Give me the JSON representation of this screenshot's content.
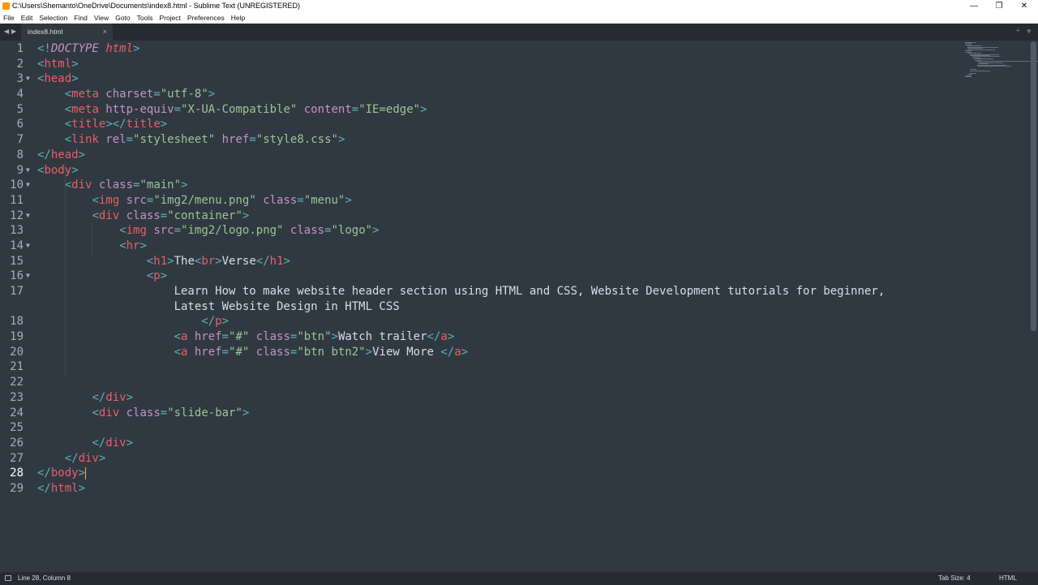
{
  "window": {
    "title": "C:\\Users\\Shemanto\\OneDrive\\Documents\\index8.html - Sublime Text (UNREGISTERED)",
    "minimize_glyph": "—",
    "restore_glyph": "❐",
    "close_glyph": "✕"
  },
  "menu": [
    "File",
    "Edit",
    "Selection",
    "Find",
    "View",
    "Goto",
    "Tools",
    "Project",
    "Preferences",
    "Help"
  ],
  "tabs": {
    "prev_arrow": "◀",
    "next_arrow": "▶",
    "active": {
      "label": "index8.html",
      "close": "×"
    },
    "new_tab_glyph": "+",
    "tab_list_glyph": "▾"
  },
  "editor": {
    "active_line": 28,
    "fold_glyph": "▼",
    "colors": {
      "tag": "#ec5f67",
      "attr": "#c594c5",
      "string": "#99c794",
      "punct": "#5fb3b3",
      "text": "#d8dee9",
      "background": "#303841",
      "cursor": "#f9ae58"
    },
    "lines": [
      {
        "n": "1",
        "fold": false,
        "tokens": [
          {
            "t": "<!",
            "c": "punct"
          },
          {
            "t": "DOCTYPE",
            "c": "attr",
            "i": true
          },
          {
            "t": " ",
            "c": "text"
          },
          {
            "t": "html",
            "c": "tag",
            "i": true
          },
          {
            "t": ">",
            "c": "punct"
          }
        ]
      },
      {
        "n": "2",
        "fold": false,
        "tokens": [
          {
            "t": "<",
            "c": "punct"
          },
          {
            "t": "html",
            "c": "tag"
          },
          {
            "t": ">",
            "c": "punct"
          }
        ]
      },
      {
        "n": "3",
        "fold": true,
        "tokens": [
          {
            "t": "<",
            "c": "punct"
          },
          {
            "t": "head",
            "c": "tag"
          },
          {
            "t": ">",
            "c": "punct"
          }
        ]
      },
      {
        "n": "4",
        "fold": false,
        "tokens": [
          {
            "t": "    ",
            "c": "text"
          },
          {
            "t": "<",
            "c": "punct"
          },
          {
            "t": "meta",
            "c": "tag"
          },
          {
            "t": " charset",
            "c": "attr"
          },
          {
            "t": "=",
            "c": "punct"
          },
          {
            "t": "\"utf-8\"",
            "c": "string"
          },
          {
            "t": ">",
            "c": "punct"
          }
        ]
      },
      {
        "n": "5",
        "fold": false,
        "tokens": [
          {
            "t": "    ",
            "c": "text"
          },
          {
            "t": "<",
            "c": "punct"
          },
          {
            "t": "meta",
            "c": "tag"
          },
          {
            "t": " http-equiv",
            "c": "attr"
          },
          {
            "t": "=",
            "c": "punct"
          },
          {
            "t": "\"X-UA-Compatible\"",
            "c": "string"
          },
          {
            "t": " content",
            "c": "attr"
          },
          {
            "t": "=",
            "c": "punct"
          },
          {
            "t": "\"IE=edge\"",
            "c": "string"
          },
          {
            "t": ">",
            "c": "punct"
          }
        ]
      },
      {
        "n": "6",
        "fold": false,
        "tokens": [
          {
            "t": "    ",
            "c": "text"
          },
          {
            "t": "<",
            "c": "punct"
          },
          {
            "t": "title",
            "c": "tag"
          },
          {
            "t": "></",
            "c": "punct"
          },
          {
            "t": "title",
            "c": "tag"
          },
          {
            "t": ">",
            "c": "punct"
          }
        ]
      },
      {
        "n": "7",
        "fold": false,
        "tokens": [
          {
            "t": "    ",
            "c": "text"
          },
          {
            "t": "<",
            "c": "punct"
          },
          {
            "t": "link",
            "c": "tag"
          },
          {
            "t": " rel",
            "c": "attr"
          },
          {
            "t": "=",
            "c": "punct"
          },
          {
            "t": "\"stylesheet\"",
            "c": "string"
          },
          {
            "t": " href",
            "c": "attr"
          },
          {
            "t": "=",
            "c": "punct"
          },
          {
            "t": "\"style8.css\"",
            "c": "string"
          },
          {
            "t": ">",
            "c": "punct"
          }
        ]
      },
      {
        "n": "8",
        "fold": false,
        "tokens": [
          {
            "t": "</",
            "c": "punct"
          },
          {
            "t": "head",
            "c": "tag"
          },
          {
            "t": ">",
            "c": "punct"
          }
        ]
      },
      {
        "n": "9",
        "fold": true,
        "tokens": [
          {
            "t": "<",
            "c": "punct"
          },
          {
            "t": "body",
            "c": "tag"
          },
          {
            "t": ">",
            "c": "punct"
          }
        ]
      },
      {
        "n": "10",
        "fold": true,
        "tokens": [
          {
            "t": "    ",
            "c": "text"
          },
          {
            "t": "<",
            "c": "punct"
          },
          {
            "t": "div",
            "c": "tag"
          },
          {
            "t": " class",
            "c": "attr"
          },
          {
            "t": "=",
            "c": "punct"
          },
          {
            "t": "\"main\"",
            "c": "string"
          },
          {
            "t": ">",
            "c": "punct"
          }
        ]
      },
      {
        "n": "11",
        "fold": false,
        "tokens": [
          {
            "t": "        ",
            "c": "text"
          },
          {
            "t": "<",
            "c": "punct"
          },
          {
            "t": "img",
            "c": "tag"
          },
          {
            "t": " src",
            "c": "attr"
          },
          {
            "t": "=",
            "c": "punct"
          },
          {
            "t": "\"img2/menu.png\"",
            "c": "string"
          },
          {
            "t": " class",
            "c": "attr"
          },
          {
            "t": "=",
            "c": "punct"
          },
          {
            "t": "\"menu\"",
            "c": "string"
          },
          {
            "t": ">",
            "c": "punct"
          }
        ]
      },
      {
        "n": "12",
        "fold": true,
        "tokens": [
          {
            "t": "        ",
            "c": "text"
          },
          {
            "t": "<",
            "c": "punct"
          },
          {
            "t": "div",
            "c": "tag"
          },
          {
            "t": " class",
            "c": "attr"
          },
          {
            "t": "=",
            "c": "punct"
          },
          {
            "t": "\"container\"",
            "c": "string"
          },
          {
            "t": ">",
            "c": "punct"
          }
        ]
      },
      {
        "n": "13",
        "fold": false,
        "tokens": [
          {
            "t": "            ",
            "c": "text"
          },
          {
            "t": "<",
            "c": "punct"
          },
          {
            "t": "img",
            "c": "tag"
          },
          {
            "t": " src",
            "c": "attr"
          },
          {
            "t": "=",
            "c": "punct"
          },
          {
            "t": "\"img2/logo.png\"",
            "c": "string"
          },
          {
            "t": " class",
            "c": "attr"
          },
          {
            "t": "=",
            "c": "punct"
          },
          {
            "t": "\"logo\"",
            "c": "string"
          },
          {
            "t": ">",
            "c": "punct"
          }
        ]
      },
      {
        "n": "14",
        "fold": true,
        "tokens": [
          {
            "t": "            ",
            "c": "text"
          },
          {
            "t": "<",
            "c": "punct"
          },
          {
            "t": "hr",
            "c": "tag"
          },
          {
            "t": ">",
            "c": "punct"
          }
        ]
      },
      {
        "n": "15",
        "fold": false,
        "tokens": [
          {
            "t": "                ",
            "c": "text"
          },
          {
            "t": "<",
            "c": "punct"
          },
          {
            "t": "h1",
            "c": "tag"
          },
          {
            "t": ">",
            "c": "punct"
          },
          {
            "t": "The",
            "c": "text"
          },
          {
            "t": "<",
            "c": "punct"
          },
          {
            "t": "br",
            "c": "tag"
          },
          {
            "t": ">",
            "c": "punct"
          },
          {
            "t": "Verse",
            "c": "text"
          },
          {
            "t": "</",
            "c": "punct"
          },
          {
            "t": "h1",
            "c": "tag"
          },
          {
            "t": ">",
            "c": "punct"
          }
        ]
      },
      {
        "n": "16",
        "fold": true,
        "tokens": [
          {
            "t": "                ",
            "c": "text"
          },
          {
            "t": "<",
            "c": "punct"
          },
          {
            "t": "p",
            "c": "tag"
          },
          {
            "t": ">",
            "c": "punct"
          }
        ]
      },
      {
        "n": "17",
        "fold": false,
        "tokens": [
          {
            "t": "                    Learn How to make website header section using HTML and CSS, Website Development tutorials for beginner,",
            "c": "text"
          }
        ]
      },
      {
        "n": "",
        "fold": false,
        "tokens": [
          {
            "t": "                    Latest Website Design in HTML CSS",
            "c": "text"
          }
        ]
      },
      {
        "n": "18",
        "fold": false,
        "tokens": [
          {
            "t": "                        ",
            "c": "text"
          },
          {
            "t": "</",
            "c": "punct"
          },
          {
            "t": "p",
            "c": "tag"
          },
          {
            "t": ">",
            "c": "punct"
          }
        ]
      },
      {
        "n": "19",
        "fold": false,
        "tokens": [
          {
            "t": "                    ",
            "c": "text"
          },
          {
            "t": "<",
            "c": "punct"
          },
          {
            "t": "a",
            "c": "tag"
          },
          {
            "t": " href",
            "c": "attr"
          },
          {
            "t": "=",
            "c": "punct"
          },
          {
            "t": "\"#\"",
            "c": "string"
          },
          {
            "t": " class",
            "c": "attr"
          },
          {
            "t": "=",
            "c": "punct"
          },
          {
            "t": "\"btn\"",
            "c": "string"
          },
          {
            "t": ">",
            "c": "punct"
          },
          {
            "t": "Watch trailer",
            "c": "text"
          },
          {
            "t": "</",
            "c": "punct"
          },
          {
            "t": "a",
            "c": "tag"
          },
          {
            "t": ">",
            "c": "punct"
          }
        ]
      },
      {
        "n": "20",
        "fold": false,
        "tokens": [
          {
            "t": "                    ",
            "c": "text"
          },
          {
            "t": "<",
            "c": "punct"
          },
          {
            "t": "a",
            "c": "tag"
          },
          {
            "t": " href",
            "c": "attr"
          },
          {
            "t": "=",
            "c": "punct"
          },
          {
            "t": "\"#\"",
            "c": "string"
          },
          {
            "t": " class",
            "c": "attr"
          },
          {
            "t": "=",
            "c": "punct"
          },
          {
            "t": "\"btn btn2\"",
            "c": "string"
          },
          {
            "t": ">",
            "c": "punct"
          },
          {
            "t": "View More ",
            "c": "text"
          },
          {
            "t": "</",
            "c": "punct"
          },
          {
            "t": "a",
            "c": "tag"
          },
          {
            "t": ">",
            "c": "punct"
          }
        ]
      },
      {
        "n": "21",
        "fold": false,
        "tokens": []
      },
      {
        "n": "22",
        "fold": false,
        "tokens": []
      },
      {
        "n": "23",
        "fold": false,
        "tokens": [
          {
            "t": "        ",
            "c": "text"
          },
          {
            "t": "</",
            "c": "punct"
          },
          {
            "t": "div",
            "c": "tag"
          },
          {
            "t": ">",
            "c": "punct"
          }
        ]
      },
      {
        "n": "24",
        "fold": false,
        "tokens": [
          {
            "t": "        ",
            "c": "text"
          },
          {
            "t": "<",
            "c": "punct"
          },
          {
            "t": "div",
            "c": "tag"
          },
          {
            "t": " class",
            "c": "attr"
          },
          {
            "t": "=",
            "c": "punct"
          },
          {
            "t": "\"slide-bar\"",
            "c": "string"
          },
          {
            "t": ">",
            "c": "punct"
          }
        ]
      },
      {
        "n": "25",
        "fold": false,
        "tokens": []
      },
      {
        "n": "26",
        "fold": false,
        "tokens": [
          {
            "t": "        ",
            "c": "text"
          },
          {
            "t": "</",
            "c": "punct"
          },
          {
            "t": "div",
            "c": "tag"
          },
          {
            "t": ">",
            "c": "punct"
          }
        ]
      },
      {
        "n": "27",
        "fold": false,
        "tokens": [
          {
            "t": "    ",
            "c": "text"
          },
          {
            "t": "</",
            "c": "punct"
          },
          {
            "t": "div",
            "c": "tag"
          },
          {
            "t": ">",
            "c": "punct"
          }
        ]
      },
      {
        "n": "28",
        "fold": false,
        "cursor": true,
        "tokens": [
          {
            "t": "</",
            "c": "punct"
          },
          {
            "t": "body",
            "c": "tag"
          },
          {
            "t": ">",
            "c": "punct"
          }
        ]
      },
      {
        "n": "29",
        "fold": false,
        "tokens": [
          {
            "t": "</",
            "c": "punct"
          },
          {
            "t": "html",
            "c": "tag"
          },
          {
            "t": ">",
            "c": "punct"
          }
        ]
      }
    ]
  },
  "status": {
    "position": "Line 28, Column 8",
    "tab_size": "Tab Size: 4",
    "syntax": "HTML"
  }
}
